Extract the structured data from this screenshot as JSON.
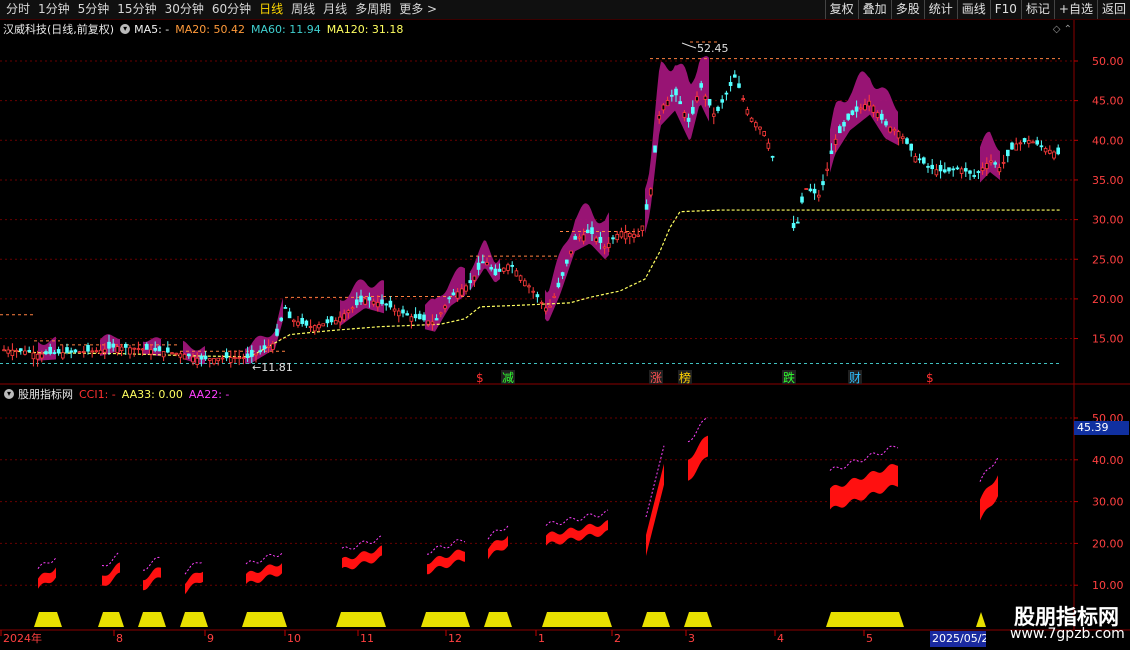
{
  "toolbar": {
    "left": [
      "分时",
      "1分钟",
      "5分钟",
      "15分钟",
      "30分钟",
      "60分钟",
      "日线",
      "周线",
      "月线",
      "多周期",
      "更多 >"
    ],
    "active": "日线",
    "right": [
      "复权",
      "叠加",
      "多股",
      "统计",
      "画线",
      "F10",
      "标记",
      "+自选",
      "返回"
    ]
  },
  "main_header": {
    "stock": "汉威科技(日线,前复权)",
    "ma5": "MA5: -",
    "ma20": "MA20: 50.42",
    "ma60": "MA60: 11.94",
    "ma120": "MA120: 31.18"
  },
  "main_axis": [
    "50.00",
    "45.00",
    "40.00",
    "35.00",
    "30.00",
    "25.00",
    "20.00",
    "15.00"
  ],
  "high_label": "52.45",
  "low_label": "11.81",
  "signals": [
    {
      "text": "$",
      "color": "#ff3030"
    },
    {
      "text": "减",
      "color": "#30ff30"
    },
    {
      "text": "涨",
      "color": "#ff5050"
    },
    {
      "text": "榜",
      "color": "#ffd000"
    },
    {
      "text": "跌",
      "color": "#30ff30"
    },
    {
      "text": "财",
      "color": "#30c0ff"
    },
    {
      "text": "$",
      "color": "#ff3030"
    }
  ],
  "sub_header": {
    "name": "股朋指标网",
    "cci": "CCI1: -",
    "aa33": "AA33: 0.00",
    "aa22": "AA22: -"
  },
  "sub_axis": [
    "50.00",
    "40.00",
    "30.00",
    "20.00",
    "10.00"
  ],
  "sub_current": "45.39",
  "time_axis": [
    "2024年",
    "8",
    "9",
    "10",
    "11",
    "12",
    "1",
    "2",
    "3",
    "4",
    "5"
  ],
  "time_current": "2025/05/2",
  "watermark": {
    "title": "股朋指标网",
    "url": "www.7gpzb.com"
  },
  "colors": {
    "up": "#ff3b3b",
    "down": "#54ffff",
    "ma": "#ffff60",
    "band": "#a0157a",
    "bar": "#ff1010",
    "yellow": "#e8e000",
    "magenta": "#ff40ff"
  }
}
